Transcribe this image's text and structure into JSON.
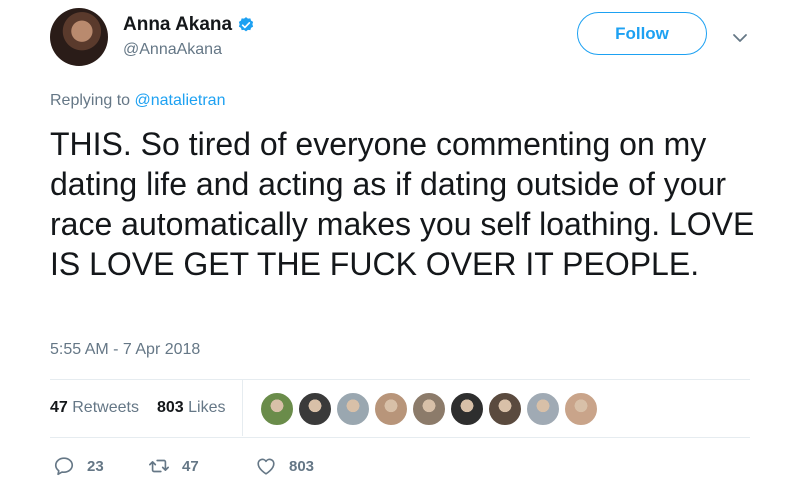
{
  "author": {
    "display_name": "Anna Akana",
    "handle": "@AnnaAkana",
    "verified": true
  },
  "follow_label": "Follow",
  "reply": {
    "prefix": "Replying to ",
    "mention": "@natalietran"
  },
  "tweet_text": "THIS. So tired of everyone commenting on my dating life and acting as if dating outside of your race automatically makes you self loathing. LOVE IS LOVE GET THE FUCK OVER IT PEOPLE.",
  "timestamp": "5:55 AM - 7 Apr 2018",
  "stats": {
    "retweets_count": "47",
    "retweets_label": "Retweets",
    "likes_count": "803",
    "likes_label": "Likes"
  },
  "liker_avatars": [
    "#6a8c4a",
    "#3a3a3a",
    "#9aa7b0",
    "#b8957a",
    "#8c7b6a",
    "#2e2e2e",
    "#5a4a3e",
    "#a0aab4",
    "#c9a48a"
  ],
  "actions": {
    "replies": "23",
    "retweets": "47",
    "likes": "803"
  },
  "colors": {
    "accent": "#1da1f2",
    "secondary_text": "#657786",
    "primary_text": "#14171a"
  }
}
